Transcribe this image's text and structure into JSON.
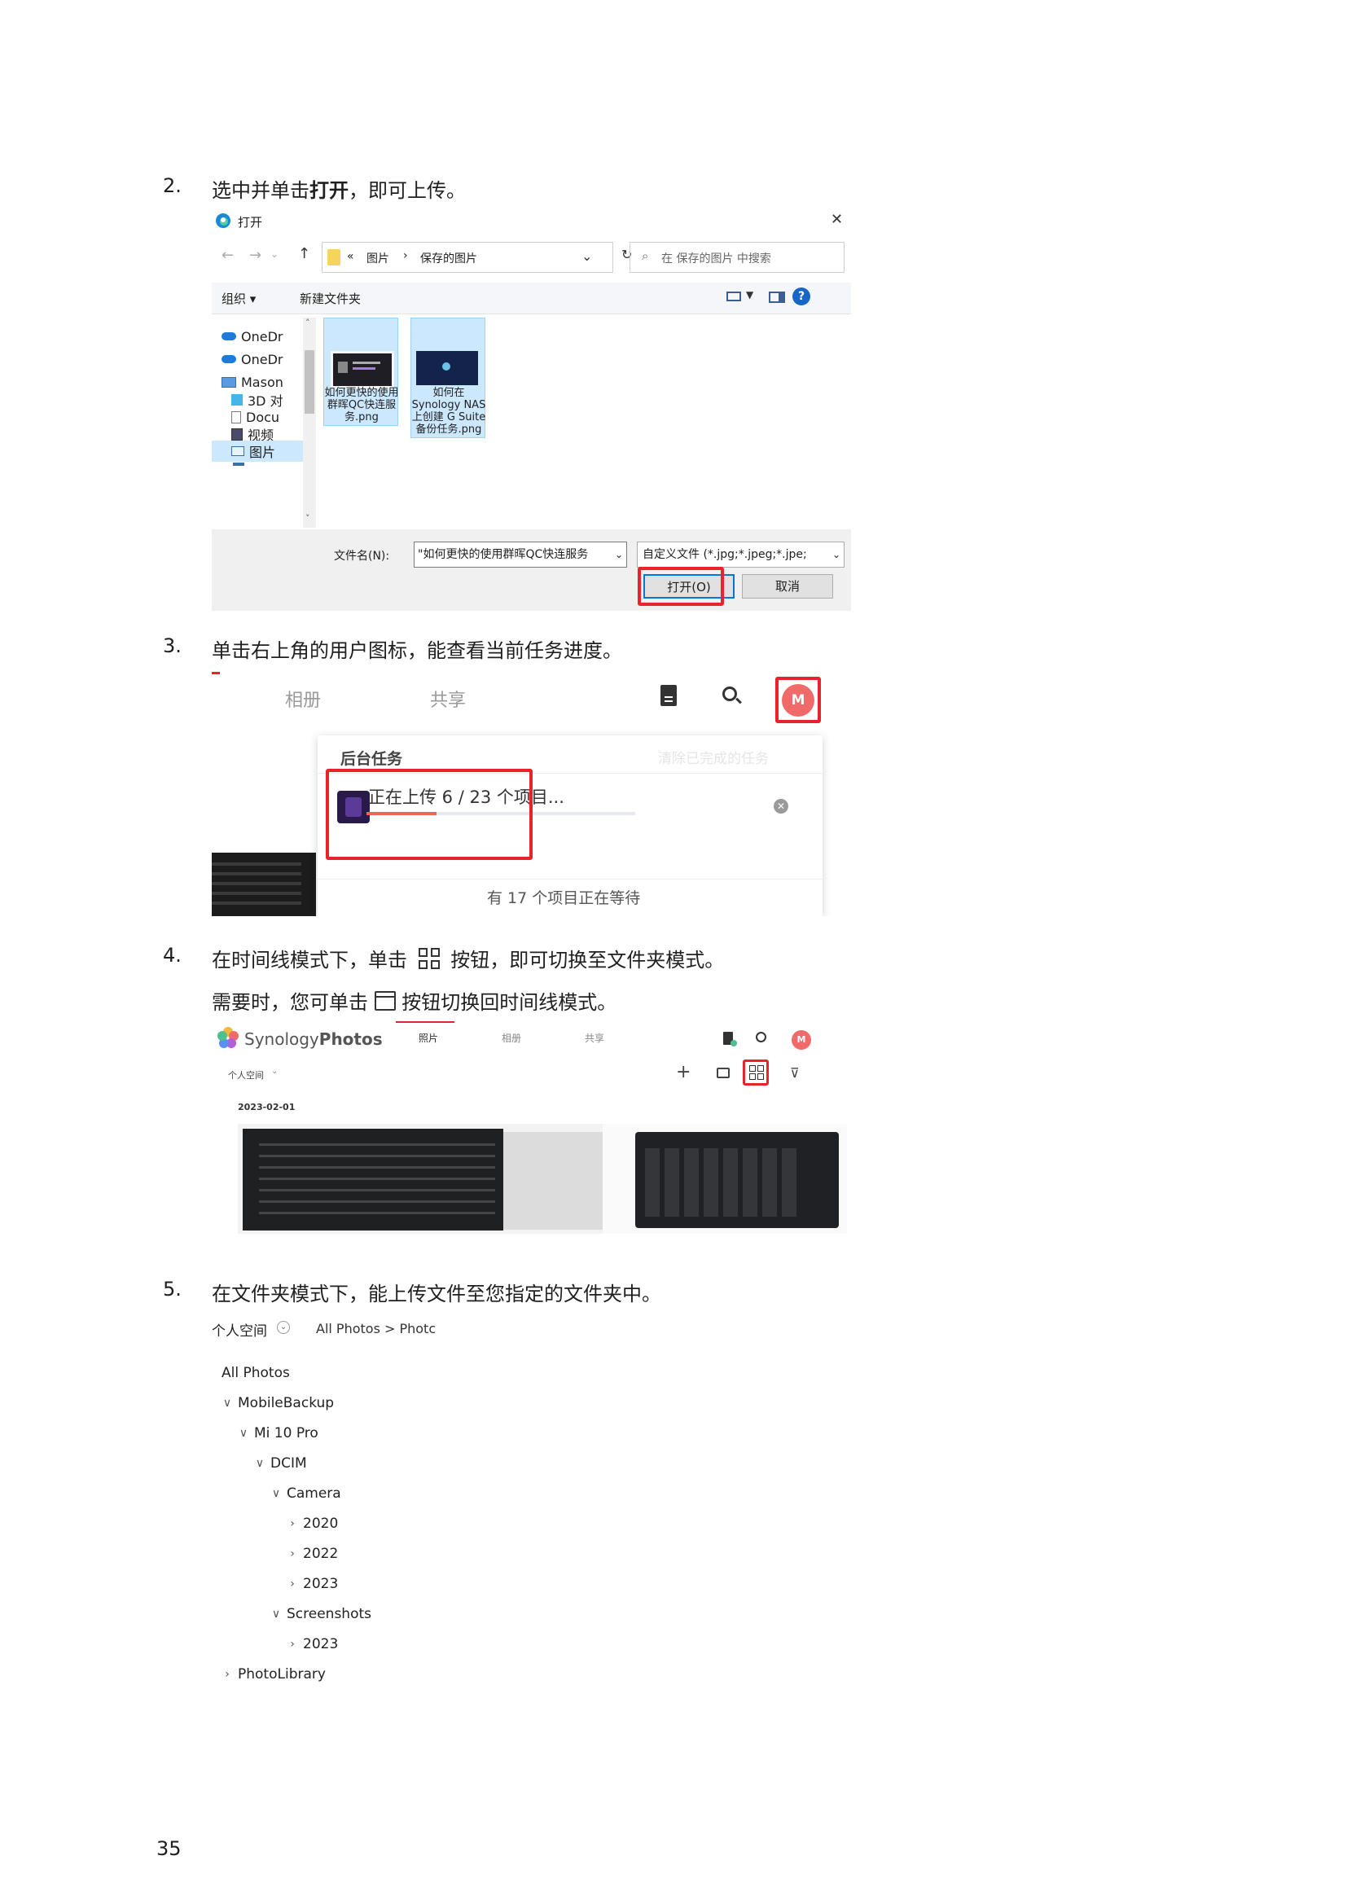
{
  "steps": {
    "s2": {
      "number": "2.",
      "text_before": "选中并单击",
      "text_bold": "打开",
      "text_after": "，即可上传。"
    },
    "s3": {
      "number": "3.",
      "text": "单击右上角的用户图标，能查看当前任务进度。"
    },
    "s4": {
      "number": "4.",
      "line1_before": "在时间线模式下，单击",
      "line1_after": "按钮，即可切换至文件夹模式。",
      "line2_before": "需要时，您可单击",
      "line2_after": "按钮切换回时间线模式。"
    },
    "s5": {
      "number": "5.",
      "text": "在文件夹模式下，能上传文件至您指定的文件夹中。"
    }
  },
  "dialog": {
    "title": "打开",
    "close_glyph": "✕",
    "breadcrumb": [
      "«",
      "图片",
      "›",
      "保存的图片"
    ],
    "search_placeholder": "在 保存的图片 中搜索",
    "organize": "组织 ▾",
    "new_folder": "新建文件夹",
    "nav_items": [
      "OneDr",
      "OneDr",
      "Mason",
      "3D 对",
      "Docu",
      "视频",
      "图片"
    ],
    "files": [
      {
        "name_l1": "如何更快的使用",
        "name_l2": "群晖QC快连服",
        "name_l3": "务.png"
      },
      {
        "name_l1": "如何在",
        "name_l2": "Synology NAS",
        "name_l3": "上创建 G Suite",
        "name_l4": "备份任务.png"
      }
    ],
    "filename_label": "文件名(N):",
    "filename_value": "\"如何更快的使用群晖QC快连服务",
    "filetype_value": "自定义文件 (*.jpg;*.jpeg;*.jpe;",
    "open_button": "打开(O)",
    "cancel_button": "取消"
  },
  "photos_tasks": {
    "tabs": [
      "相册",
      "共享"
    ],
    "avatar_letter": "M",
    "panel_title": "后台任务",
    "clear_label": "清除已完成的任务",
    "uploading_text": "正在上传 6 / 23 个项目...",
    "progress": 0.26,
    "waiting_text": "有 17 个项目正在等待"
  },
  "photos_timeline": {
    "brand_light": "Synology",
    "brand_bold": "Photos",
    "tabs": [
      "照片",
      "相册",
      "共享"
    ],
    "space_label": "个人空间",
    "date_label": "2023-02-01",
    "avatar_letter": "M"
  },
  "folder_view": {
    "space_label": "个人空间",
    "breadcrumb": "All Photos > Photc",
    "tree": [
      {
        "label": "All Photos",
        "chev": ""
      },
      {
        "label": "MobileBackup",
        "chev": "∨"
      },
      {
        "label": "Mi 10 Pro",
        "chev": "∨"
      },
      {
        "label": "DCIM",
        "chev": "∨"
      },
      {
        "label": "Camera",
        "chev": "∨"
      },
      {
        "label": "2020",
        "chev": "›"
      },
      {
        "label": "2022",
        "chev": "›"
      },
      {
        "label": "2023",
        "chev": "›"
      },
      {
        "label": "Screenshots",
        "chev": "∨"
      },
      {
        "label": "2023",
        "chev": "›"
      },
      {
        "label": "PhotoLibrary",
        "chev": "›"
      }
    ]
  },
  "page_number": "35",
  "colors": {
    "highlight_red": "#e8232b",
    "avatar": "#f06a6a",
    "selection": "#cce8ff",
    "progress": "#f0625a"
  }
}
